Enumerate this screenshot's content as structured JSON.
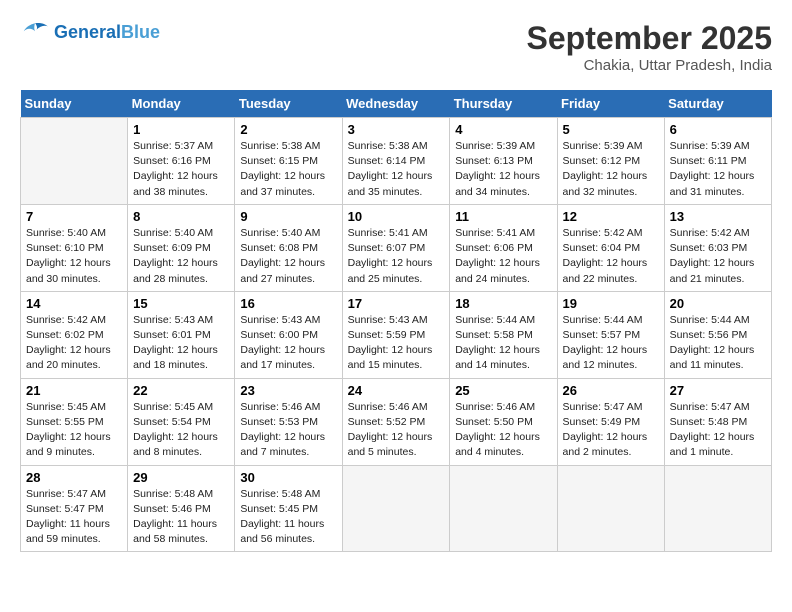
{
  "app": {
    "name": "GeneralBlue",
    "name_part1": "General",
    "name_part2": "Blue"
  },
  "calendar": {
    "month": "September 2025",
    "location": "Chakia, Uttar Pradesh, India",
    "days_of_week": [
      "Sunday",
      "Monday",
      "Tuesday",
      "Wednesday",
      "Thursday",
      "Friday",
      "Saturday"
    ],
    "weeks": [
      [
        {
          "day": "",
          "info": ""
        },
        {
          "day": "1",
          "info": "Sunrise: 5:37 AM\nSunset: 6:16 PM\nDaylight: 12 hours\nand 38 minutes."
        },
        {
          "day": "2",
          "info": "Sunrise: 5:38 AM\nSunset: 6:15 PM\nDaylight: 12 hours\nand 37 minutes."
        },
        {
          "day": "3",
          "info": "Sunrise: 5:38 AM\nSunset: 6:14 PM\nDaylight: 12 hours\nand 35 minutes."
        },
        {
          "day": "4",
          "info": "Sunrise: 5:39 AM\nSunset: 6:13 PM\nDaylight: 12 hours\nand 34 minutes."
        },
        {
          "day": "5",
          "info": "Sunrise: 5:39 AM\nSunset: 6:12 PM\nDaylight: 12 hours\nand 32 minutes."
        },
        {
          "day": "6",
          "info": "Sunrise: 5:39 AM\nSunset: 6:11 PM\nDaylight: 12 hours\nand 31 minutes."
        }
      ],
      [
        {
          "day": "7",
          "info": "Sunrise: 5:40 AM\nSunset: 6:10 PM\nDaylight: 12 hours\nand 30 minutes."
        },
        {
          "day": "8",
          "info": "Sunrise: 5:40 AM\nSunset: 6:09 PM\nDaylight: 12 hours\nand 28 minutes."
        },
        {
          "day": "9",
          "info": "Sunrise: 5:40 AM\nSunset: 6:08 PM\nDaylight: 12 hours\nand 27 minutes."
        },
        {
          "day": "10",
          "info": "Sunrise: 5:41 AM\nSunset: 6:07 PM\nDaylight: 12 hours\nand 25 minutes."
        },
        {
          "day": "11",
          "info": "Sunrise: 5:41 AM\nSunset: 6:06 PM\nDaylight: 12 hours\nand 24 minutes."
        },
        {
          "day": "12",
          "info": "Sunrise: 5:42 AM\nSunset: 6:04 PM\nDaylight: 12 hours\nand 22 minutes."
        },
        {
          "day": "13",
          "info": "Sunrise: 5:42 AM\nSunset: 6:03 PM\nDaylight: 12 hours\nand 21 minutes."
        }
      ],
      [
        {
          "day": "14",
          "info": "Sunrise: 5:42 AM\nSunset: 6:02 PM\nDaylight: 12 hours\nand 20 minutes."
        },
        {
          "day": "15",
          "info": "Sunrise: 5:43 AM\nSunset: 6:01 PM\nDaylight: 12 hours\nand 18 minutes."
        },
        {
          "day": "16",
          "info": "Sunrise: 5:43 AM\nSunset: 6:00 PM\nDaylight: 12 hours\nand 17 minutes."
        },
        {
          "day": "17",
          "info": "Sunrise: 5:43 AM\nSunset: 5:59 PM\nDaylight: 12 hours\nand 15 minutes."
        },
        {
          "day": "18",
          "info": "Sunrise: 5:44 AM\nSunset: 5:58 PM\nDaylight: 12 hours\nand 14 minutes."
        },
        {
          "day": "19",
          "info": "Sunrise: 5:44 AM\nSunset: 5:57 PM\nDaylight: 12 hours\nand 12 minutes."
        },
        {
          "day": "20",
          "info": "Sunrise: 5:44 AM\nSunset: 5:56 PM\nDaylight: 12 hours\nand 11 minutes."
        }
      ],
      [
        {
          "day": "21",
          "info": "Sunrise: 5:45 AM\nSunset: 5:55 PM\nDaylight: 12 hours\nand 9 minutes."
        },
        {
          "day": "22",
          "info": "Sunrise: 5:45 AM\nSunset: 5:54 PM\nDaylight: 12 hours\nand 8 minutes."
        },
        {
          "day": "23",
          "info": "Sunrise: 5:46 AM\nSunset: 5:53 PM\nDaylight: 12 hours\nand 7 minutes."
        },
        {
          "day": "24",
          "info": "Sunrise: 5:46 AM\nSunset: 5:52 PM\nDaylight: 12 hours\nand 5 minutes."
        },
        {
          "day": "25",
          "info": "Sunrise: 5:46 AM\nSunset: 5:50 PM\nDaylight: 12 hours\nand 4 minutes."
        },
        {
          "day": "26",
          "info": "Sunrise: 5:47 AM\nSunset: 5:49 PM\nDaylight: 12 hours\nand 2 minutes."
        },
        {
          "day": "27",
          "info": "Sunrise: 5:47 AM\nSunset: 5:48 PM\nDaylight: 12 hours\nand 1 minute."
        }
      ],
      [
        {
          "day": "28",
          "info": "Sunrise: 5:47 AM\nSunset: 5:47 PM\nDaylight: 11 hours\nand 59 minutes."
        },
        {
          "day": "29",
          "info": "Sunrise: 5:48 AM\nSunset: 5:46 PM\nDaylight: 11 hours\nand 58 minutes."
        },
        {
          "day": "30",
          "info": "Sunrise: 5:48 AM\nSunset: 5:45 PM\nDaylight: 11 hours\nand 56 minutes."
        },
        {
          "day": "",
          "info": ""
        },
        {
          "day": "",
          "info": ""
        },
        {
          "day": "",
          "info": ""
        },
        {
          "day": "",
          "info": ""
        }
      ]
    ]
  }
}
